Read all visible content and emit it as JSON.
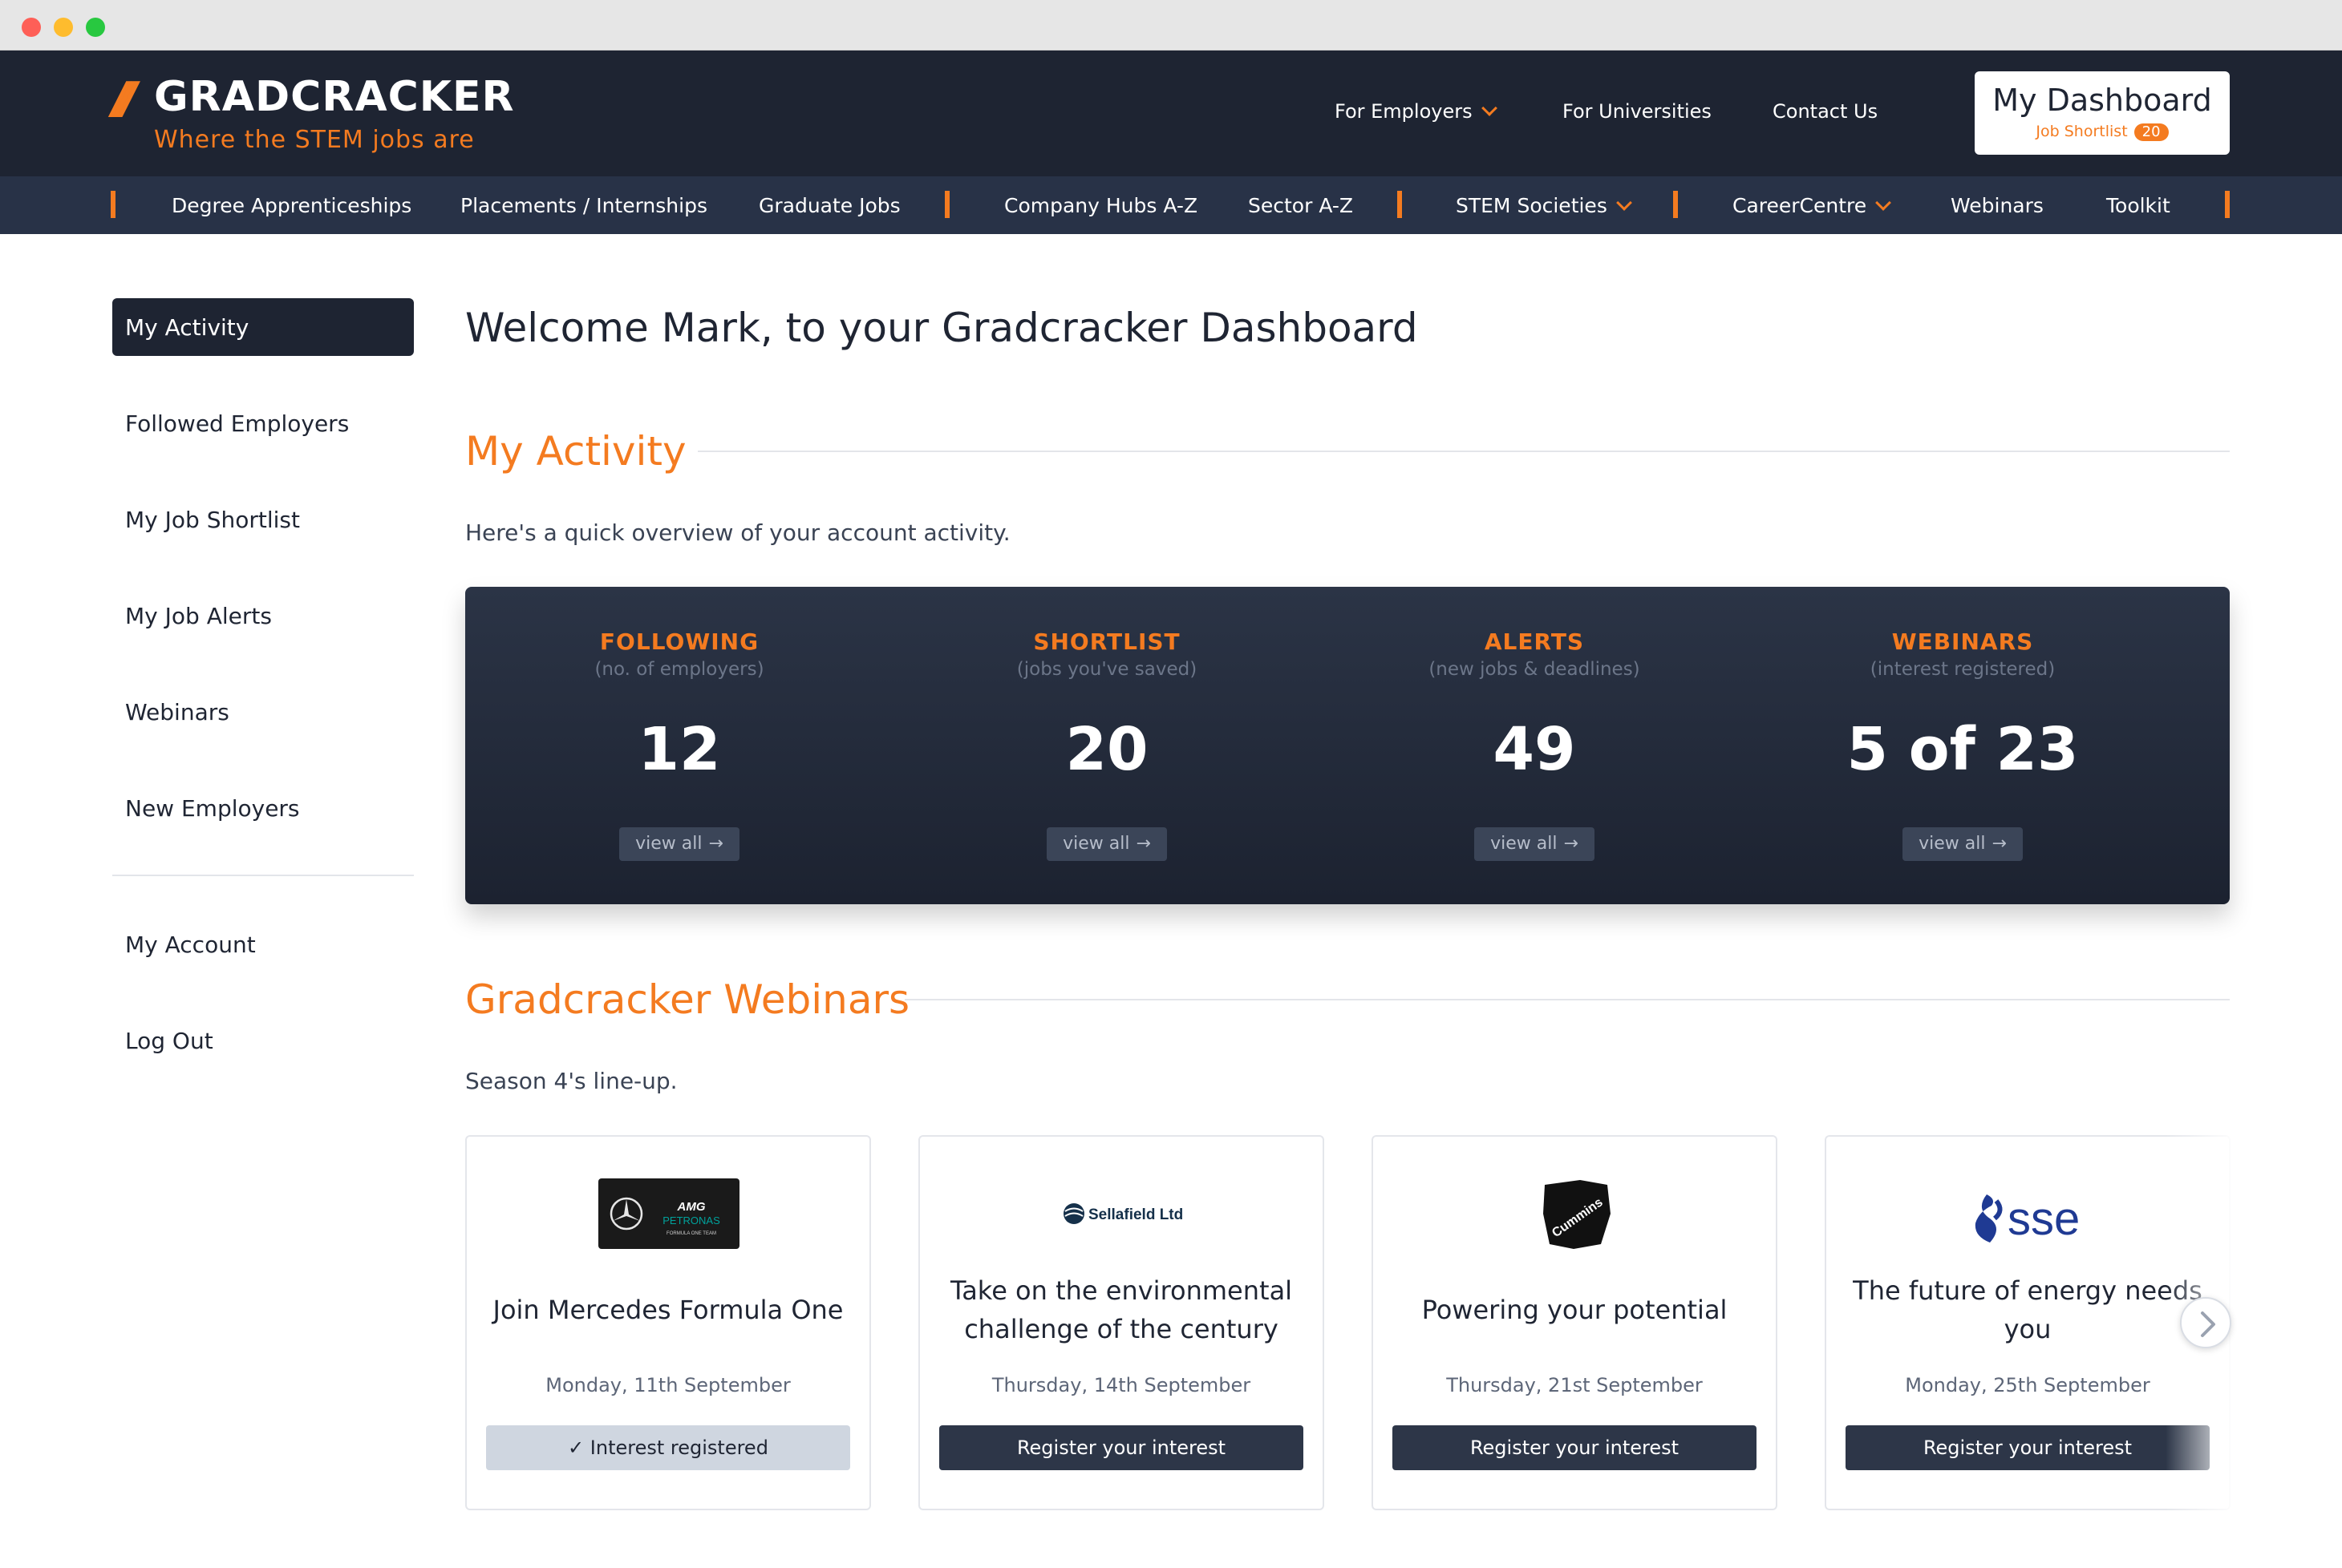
{
  "header": {
    "logo_slashes": "///",
    "logo_name": "GRADCRACKER",
    "logo_tagline": "Where the STEM jobs are",
    "nav": [
      {
        "label": "For Employers"
      },
      {
        "label": "For Universities"
      },
      {
        "label": "Contact Us"
      }
    ],
    "dashboard": {
      "title": "My Dashboard",
      "sub_label": "Job Shortlist",
      "badge": "20"
    }
  },
  "subnav": {
    "items": [
      {
        "label": "Degree Apprenticeships"
      },
      {
        "label": "Placements / Internships"
      },
      {
        "label": "Graduate Jobs"
      },
      {
        "label": "Company Hubs A-Z"
      },
      {
        "label": "Sector A-Z"
      },
      {
        "label": "STEM Societies"
      },
      {
        "label": "CareerCentre"
      },
      {
        "label": "Webinars"
      },
      {
        "label": "Toolkit"
      }
    ]
  },
  "sidebar": {
    "items": [
      {
        "label": "My Activity"
      },
      {
        "label": "Followed Employers"
      },
      {
        "label": "My Job Shortlist"
      },
      {
        "label": "My Job Alerts"
      },
      {
        "label": "Webinars"
      },
      {
        "label": "New Employers"
      },
      {
        "label": "My Account"
      },
      {
        "label": "Log Out"
      }
    ]
  },
  "main": {
    "welcome": "Welcome Mark, to your Gradcracker Dashboard",
    "activity": {
      "title": "My Activity",
      "subtitle": "Here's a quick overview of your account activity.",
      "stats": [
        {
          "label": "FOLLOWING",
          "sub": "(no. of employers)",
          "value": "12",
          "button": "view all"
        },
        {
          "label": "SHORTLIST",
          "sub": "(jobs you've saved)",
          "value": "20",
          "button": "view all"
        },
        {
          "label": "ALERTS",
          "sub": "(new jobs & deadlines)",
          "value": "49",
          "button": "view all"
        },
        {
          "label": "WEBINARS",
          "sub": "(interest registered)",
          "value": "5 of 23",
          "button": "view all"
        }
      ]
    },
    "webinars": {
      "title": "Gradcracker Webinars",
      "subtitle": "Season 4's line-up.",
      "cards": [
        {
          "logo": "mercedes-amg-petronas-logo",
          "logo_text": "AMG",
          "logo_sub": "PETRONAS",
          "logo_sub2": "FORMULA ONE TEAM",
          "title": "Join Mercedes Formula One",
          "date": "Monday, 11th September",
          "button": "✓ Interest registered"
        },
        {
          "logo": "sellafield-logo",
          "logo_text": "Sellafield Ltd",
          "title_line1": "Take on the environmental",
          "title_line2": "challenge of the century",
          "date": "Thursday, 14th September",
          "button": "Register your interest"
        },
        {
          "logo": "cummins-logo",
          "logo_text": "Cummins",
          "title": "Powering your potential",
          "date": "Thursday, 21st September",
          "button": "Register your interest"
        },
        {
          "logo": "sse-logo",
          "logo_text": "sse",
          "title_line1": "The future of energy needs",
          "title_line2": "you",
          "date": "Monday, 25th September",
          "button": "Register your interest"
        }
      ]
    }
  },
  "colors": {
    "accent": "#f47b20",
    "navy": "#1e2432",
    "panel": "#283247"
  }
}
